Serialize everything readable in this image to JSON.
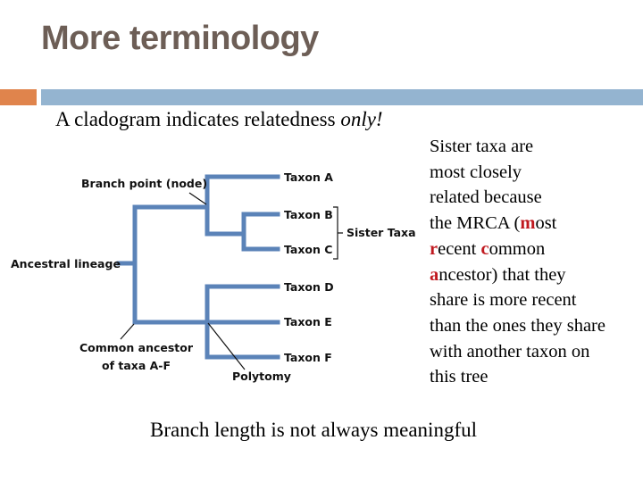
{
  "slide": {
    "title": "More terminology",
    "subtitle_prefix": "A cladogram indicates relatedness ",
    "subtitle_emphasis": "only!",
    "bottom_text": "Branch length is not always meaningful",
    "accent_colors": {
      "orange": "#e0844c",
      "blue": "#94b4d0",
      "title": "#6d5e56",
      "highlight": "#c0191f",
      "branch": "#5b83b8"
    }
  },
  "side_text": {
    "lines": [
      [
        {
          "t": "Sister taxa are"
        }
      ],
      [
        {
          "t": "most closely"
        }
      ],
      [
        {
          "t": "related because"
        }
      ],
      [
        {
          "t": "the MRCA ("
        },
        {
          "t": "m",
          "red": true
        },
        {
          "t": "ost"
        }
      ],
      [
        {
          "t": "r",
          "red": true
        },
        {
          "t": "ecent "
        },
        {
          "t": "c",
          "red": true
        },
        {
          "t": "ommon"
        }
      ],
      [
        {
          "t": "a",
          "red": true
        },
        {
          "t": "ncestor) that they"
        }
      ],
      [
        {
          "t": "share is more recent"
        }
      ],
      [
        {
          "t": "than the ones they share"
        }
      ],
      [
        {
          "t": "with another taxon on"
        }
      ],
      [
        {
          "t": "this tree"
        }
      ]
    ]
  },
  "cladogram": {
    "taxa": [
      "Taxon A",
      "Taxon B",
      "Taxon C",
      "Taxon D",
      "Taxon E",
      "Taxon F"
    ],
    "labels": {
      "branch_point": "Branch point (node)",
      "ancestral_lineage": "Ancestral lineage",
      "common_ancestor_line1": "Common ancestor",
      "common_ancestor_line2": "of taxa A-F",
      "polytomy": "Polytomy",
      "sister_taxa": "Sister Taxa"
    },
    "tree": "(((A,(B,C)),(D,E,F)))"
  }
}
